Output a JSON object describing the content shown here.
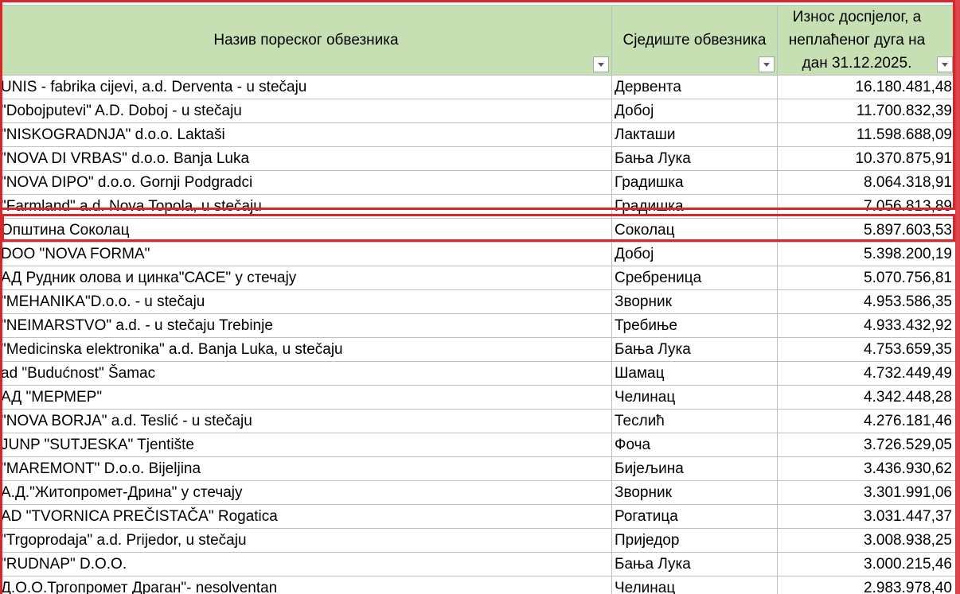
{
  "header": {
    "col_name": "Назив пореског обвезника",
    "col_seat": "Сједиште обвезника",
    "col_amount": "Износ доспјелог, а неплаћеног дуга на дан 31.12.2025."
  },
  "rows": [
    {
      "name": "UNIS - fabrika cijevi, a.d. Derventa - u  stečaju",
      "seat": "Дервента",
      "amount": "16.180.481,48"
    },
    {
      "name": "\"Dobojputevi\" A.D. Doboj - u stečaju",
      "seat": "Добој",
      "amount": "11.700.832,39"
    },
    {
      "name": "\"NISKOGRADNJA\" d.o.o. Laktaši",
      "seat": "Лакташи",
      "amount": "11.598.688,09"
    },
    {
      "name": "\"NOVA DI VRBAS\" d.o.o. Banja Luka",
      "seat": "Бања Лука",
      "amount": "10.370.875,91"
    },
    {
      "name": "\"NOVA DIPO\" d.o.o. Gornji Podgradci",
      "seat": "Градишка",
      "amount": "8.064.318,91"
    },
    {
      "name": "\"Farmland\" a.d. Nova Topola, u stečaju",
      "seat": "Градишка",
      "amount": "7.056.813,89"
    },
    {
      "name": "Општина Соколац",
      "seat": "Соколац",
      "amount": "5.897.603,53"
    },
    {
      "name": "DOO  \"NOVA FORMA\"",
      "seat": "Добој",
      "amount": "5.398.200,19"
    },
    {
      "name": "АД Рудник олова и цинка\"САСЕ\" у стечају",
      "seat": "Сребреница",
      "amount": "5.070.756,81"
    },
    {
      "name": "\"MEHANIKA\"D.o.o. - u stečaju",
      "seat": "Зворник",
      "amount": "4.953.586,35"
    },
    {
      "name": "\"NEIMARSTVO\" a.d.  - u stečaju Trebinje",
      "seat": "Требиње",
      "amount": "4.933.432,92"
    },
    {
      "name": "\"Medicinska elektronika\" a.d. Banja Luka, u stečaju",
      "seat": "Бања Лука",
      "amount": "4.753.659,35"
    },
    {
      "name": "ad \"Budućnost\" Šamac",
      "seat": "Шамац",
      "amount": "4.732.449,49"
    },
    {
      "name": "АД \"МЕРМЕР\"",
      "seat": "Челинац",
      "amount": "4.342.448,28"
    },
    {
      "name": "\"NOVA BORJA\" a.d. Teslić - u stečaju",
      "seat": "Теслић",
      "amount": "4.276.181,46"
    },
    {
      "name": "JUNP \"SUTJESKA\" Tjentište",
      "seat": "Фоча",
      "amount": "3.726.529,05"
    },
    {
      "name": "\"MAREMONT\" D.o.o. Bijeljina",
      "seat": "Бијељина",
      "amount": "3.436.930,62"
    },
    {
      "name": "А.Д.\"Житопромет-Дрина\" у стечају",
      "seat": "Зворник",
      "amount": "3.301.991,06"
    },
    {
      "name": "AD \"TVORNICA PREČISTAČA\" Rogatica",
      "seat": "Рогатица",
      "amount": "3.031.447,37"
    },
    {
      "name": "\"Trgoprodaja\" a.d. Prijedor, u stečaju",
      "seat": "Приједор",
      "amount": "3.008.938,25"
    },
    {
      "name": "\"RUDNAP\" D.O.O.",
      "seat": "Бања Лука",
      "amount": "3.000.215,46"
    },
    {
      "name": "Д.О.О.Тргопромет Драган\"- nesolventan",
      "seat": "Челинац",
      "amount": "2.983.978,40"
    }
  ]
}
